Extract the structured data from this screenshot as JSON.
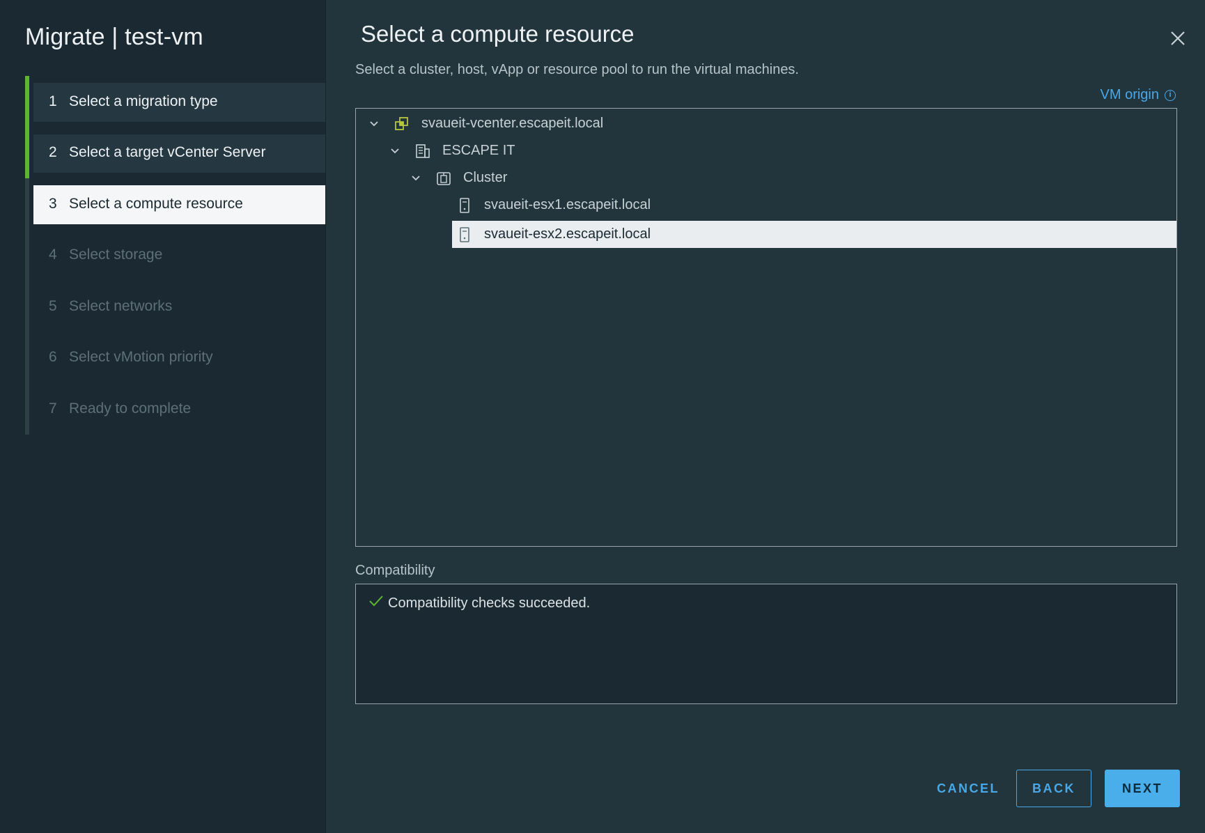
{
  "wizard": {
    "title": "Migrate | test-vm",
    "steps": [
      {
        "num": "1",
        "label": "Select a migration type",
        "state": "done"
      },
      {
        "num": "2",
        "label": "Select a target vCenter Server",
        "state": "done"
      },
      {
        "num": "3",
        "label": "Select a compute resource",
        "state": "active"
      },
      {
        "num": "4",
        "label": "Select storage",
        "state": "pending"
      },
      {
        "num": "5",
        "label": "Select networks",
        "state": "pending"
      },
      {
        "num": "6",
        "label": "Select vMotion priority",
        "state": "pending"
      },
      {
        "num": "7",
        "label": "Ready to complete",
        "state": "pending"
      }
    ]
  },
  "page": {
    "title": "Select a compute resource",
    "description": "Select a cluster, host, vApp or resource pool to run the virtual machines.",
    "vm_origin": "VM origin",
    "info_glyph": "i"
  },
  "tree": {
    "nodes": [
      {
        "label": "svaueit-vcenter.escapeit.local",
        "icon": "vcenter-icon",
        "expanded": true
      },
      {
        "label": "ESCAPE IT",
        "icon": "datacenter-icon",
        "expanded": true
      },
      {
        "label": "Cluster",
        "icon": "cluster-icon",
        "expanded": true
      },
      {
        "label": "svaueit-esx1.escapeit.local",
        "icon": "host-icon"
      },
      {
        "label": "svaueit-esx2.escapeit.local",
        "icon": "host-icon",
        "selected": true
      }
    ]
  },
  "compatibility": {
    "label": "Compatibility",
    "message": "Compatibility checks succeeded."
  },
  "buttons": {
    "cancel": "CANCEL",
    "back": "BACK",
    "next": "NEXT"
  },
  "colors": {
    "accent": "#48a8e8",
    "done_bar": "#5fb531",
    "success": "#5fb531"
  }
}
